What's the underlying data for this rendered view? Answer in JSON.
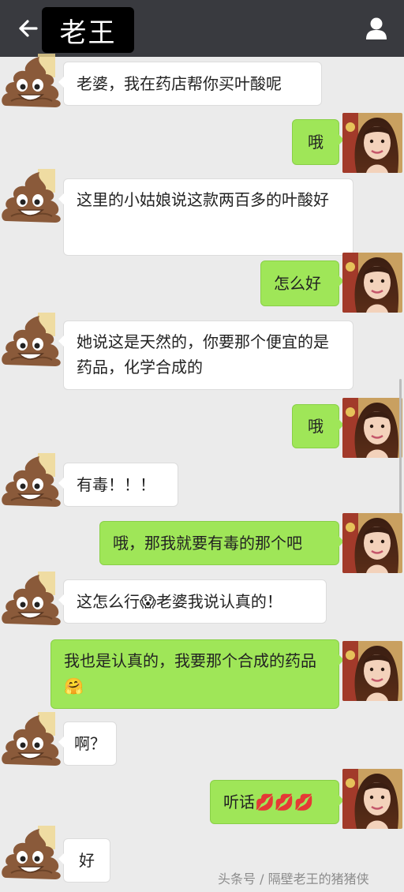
{
  "header": {
    "title": "老王",
    "back_icon": "arrow-left-icon",
    "profile_icon": "person-icon"
  },
  "messages": [
    {
      "side": "in",
      "text": "老婆，我在药店帮你买叶酸呢"
    },
    {
      "side": "out",
      "text": "哦"
    },
    {
      "side": "in",
      "text": "这里的小姑娘说这款两百多的叶酸好"
    },
    {
      "side": "out",
      "text": "怎么好"
    },
    {
      "side": "in",
      "text": "她说这是天然的，你要那个便宜的是药品，化学合成的"
    },
    {
      "side": "out",
      "text": "哦"
    },
    {
      "side": "in",
      "text": "有毒！！！"
    },
    {
      "side": "out",
      "text": "哦，那我就要有毒的那个吧"
    },
    {
      "side": "in",
      "text": "这怎么行😱老婆我说认真的！"
    },
    {
      "side": "out",
      "text": "我也是认真的，我要那个合成的药品🤗"
    },
    {
      "side": "in",
      "text": "啊？"
    },
    {
      "side": "out",
      "text": "听话💋💋💋"
    },
    {
      "side": "in",
      "text": "好"
    }
  ],
  "watermark": "头条号 / 隔壁老王的猪猪侠",
  "colors": {
    "header_bg": "#393a3f",
    "page_bg": "#ebebeb",
    "bubble_out": "#9fe658",
    "bubble_in": "#ffffff"
  }
}
